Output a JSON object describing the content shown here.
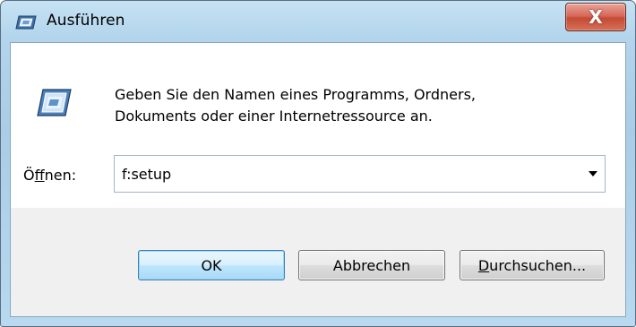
{
  "window": {
    "title": "Ausführen",
    "close_symbol": "X",
    "title_icon": "run-icon"
  },
  "dialog": {
    "icon": "run-icon",
    "description_line1": "Geben Sie den Namen eines Programms, Ordners,",
    "description_line2": "Dokuments oder einer Internetressource an.",
    "open_label_prefix": "Ö",
    "open_label_accel": "f",
    "open_label_suffix": "fnen:",
    "open_value": "f:setup"
  },
  "buttons": {
    "ok": "OK",
    "cancel": "Abbrechen",
    "browse_accel": "D",
    "browse_rest": "urchsuchen..."
  },
  "colors": {
    "title_gradient": "#b2d4ec",
    "close_button": "#c54a34",
    "default_button_border": "#3c7fb1",
    "footer_bg": "#f0f0f0"
  }
}
